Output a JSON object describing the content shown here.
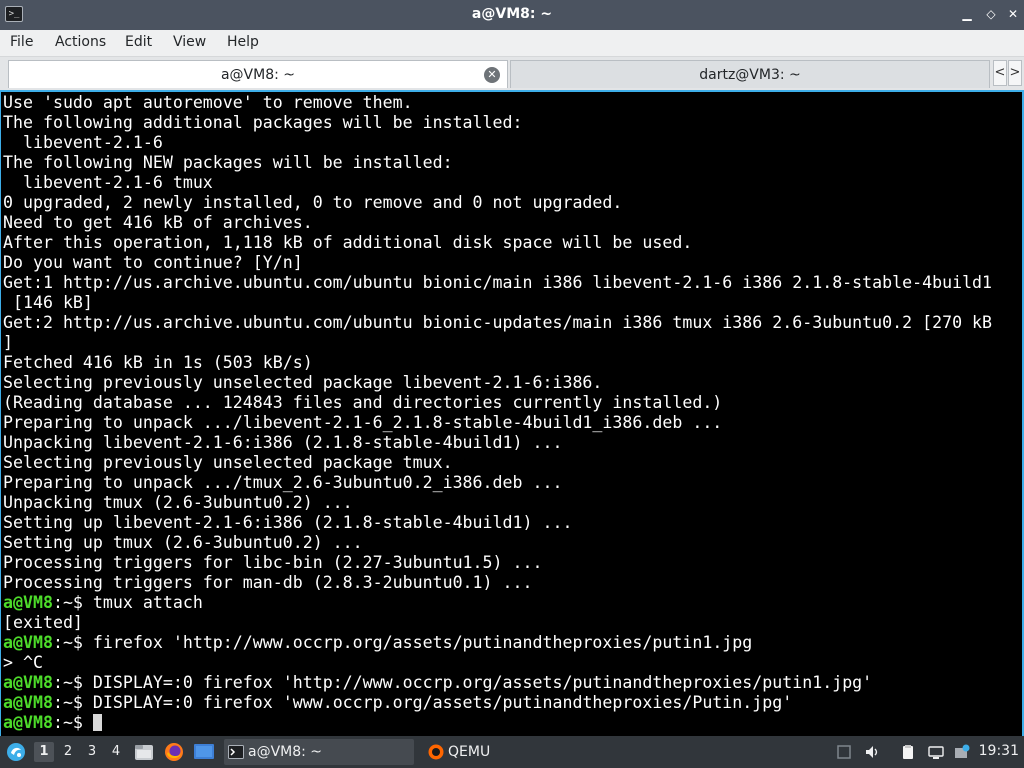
{
  "window": {
    "title": "a@VM8: ~",
    "minimize_glyph": "▁",
    "restore_glyph": "◇",
    "close_glyph": "✕"
  },
  "menubar": [
    "File",
    "Actions",
    "Edit",
    "View",
    "Help"
  ],
  "tabs": [
    {
      "label": "a@VM8: ~",
      "active": true
    },
    {
      "label": "dartz@VM3: ~",
      "active": false
    }
  ],
  "tab_scroll": {
    "left": "<",
    "right": ">"
  },
  "terminal": {
    "prompt_user": "a@VM8",
    "prompt_sep": ":~$ ",
    "lines": [
      {
        "text": "Use 'sudo apt autoremove' to remove them."
      },
      {
        "text": "The following additional packages will be installed:"
      },
      {
        "text": "  libevent-2.1-6"
      },
      {
        "text": "The following NEW packages will be installed:"
      },
      {
        "text": "  libevent-2.1-6 tmux"
      },
      {
        "text": "0 upgraded, 2 newly installed, 0 to remove and 0 not upgraded."
      },
      {
        "text": "Need to get 416 kB of archives."
      },
      {
        "text": "After this operation, 1,118 kB of additional disk space will be used."
      },
      {
        "text": "Do you want to continue? [Y/n]"
      },
      {
        "text": "Get:1 http://us.archive.ubuntu.com/ubuntu bionic/main i386 libevent-2.1-6 i386 2.1.8-stable-4build1"
      },
      {
        "text": " [146 kB]"
      },
      {
        "text": "Get:2 http://us.archive.ubuntu.com/ubuntu bionic-updates/main i386 tmux i386 2.6-3ubuntu0.2 [270 kB"
      },
      {
        "text": "]"
      },
      {
        "text": "Fetched 416 kB in 1s (503 kB/s)"
      },
      {
        "text": "Selecting previously unselected package libevent-2.1-6:i386."
      },
      {
        "text": "(Reading database ... 124843 files and directories currently installed.)"
      },
      {
        "text": "Preparing to unpack .../libevent-2.1-6_2.1.8-stable-4build1_i386.deb ..."
      },
      {
        "text": "Unpacking libevent-2.1-6:i386 (2.1.8-stable-4build1) ..."
      },
      {
        "text": "Selecting previously unselected package tmux."
      },
      {
        "text": "Preparing to unpack .../tmux_2.6-3ubuntu0.2_i386.deb ..."
      },
      {
        "text": "Unpacking tmux (2.6-3ubuntu0.2) ..."
      },
      {
        "text": "Setting up libevent-2.1-6:i386 (2.1.8-stable-4build1) ..."
      },
      {
        "text": "Setting up tmux (2.6-3ubuntu0.2) ..."
      },
      {
        "text": "Processing triggers for libc-bin (2.27-3ubuntu1.5) ..."
      },
      {
        "text": "Processing triggers for man-db (2.8.3-2ubuntu0.1) ..."
      },
      {
        "prompt": true,
        "text": "tmux attach"
      },
      {
        "text": "[exited]"
      },
      {
        "prompt": true,
        "text": "firefox 'http://www.occrp.org/assets/putinandtheproxies/putin1.jpg"
      },
      {
        "text": "> ^C"
      },
      {
        "prompt": true,
        "text": "DISPLAY=:0 firefox 'http://www.occrp.org/assets/putinandtheproxies/putin1.jpg'"
      },
      {
        "prompt": true,
        "text": "DISPLAY=:0 firefox 'www.occrp.org/assets/putinandtheproxies/Putin.jpg'"
      },
      {
        "prompt": true,
        "text": "",
        "cursor": true
      }
    ]
  },
  "taskbar": {
    "workspaces": [
      "1",
      "2",
      "3",
      "4"
    ],
    "tasks": [
      {
        "label": "a@VM8: ~",
        "icon": "terminal-icon"
      },
      {
        "label": "QEMU",
        "icon": "qemu-icon"
      }
    ],
    "clock": "19:31"
  },
  "colors": {
    "titlebar": "#4b5360",
    "terminal_bg": "#000000",
    "terminal_fg": "#ffffff",
    "prompt": "#4ddc2a",
    "focus_border": "#3daee9",
    "taskbar": "#31363b"
  }
}
